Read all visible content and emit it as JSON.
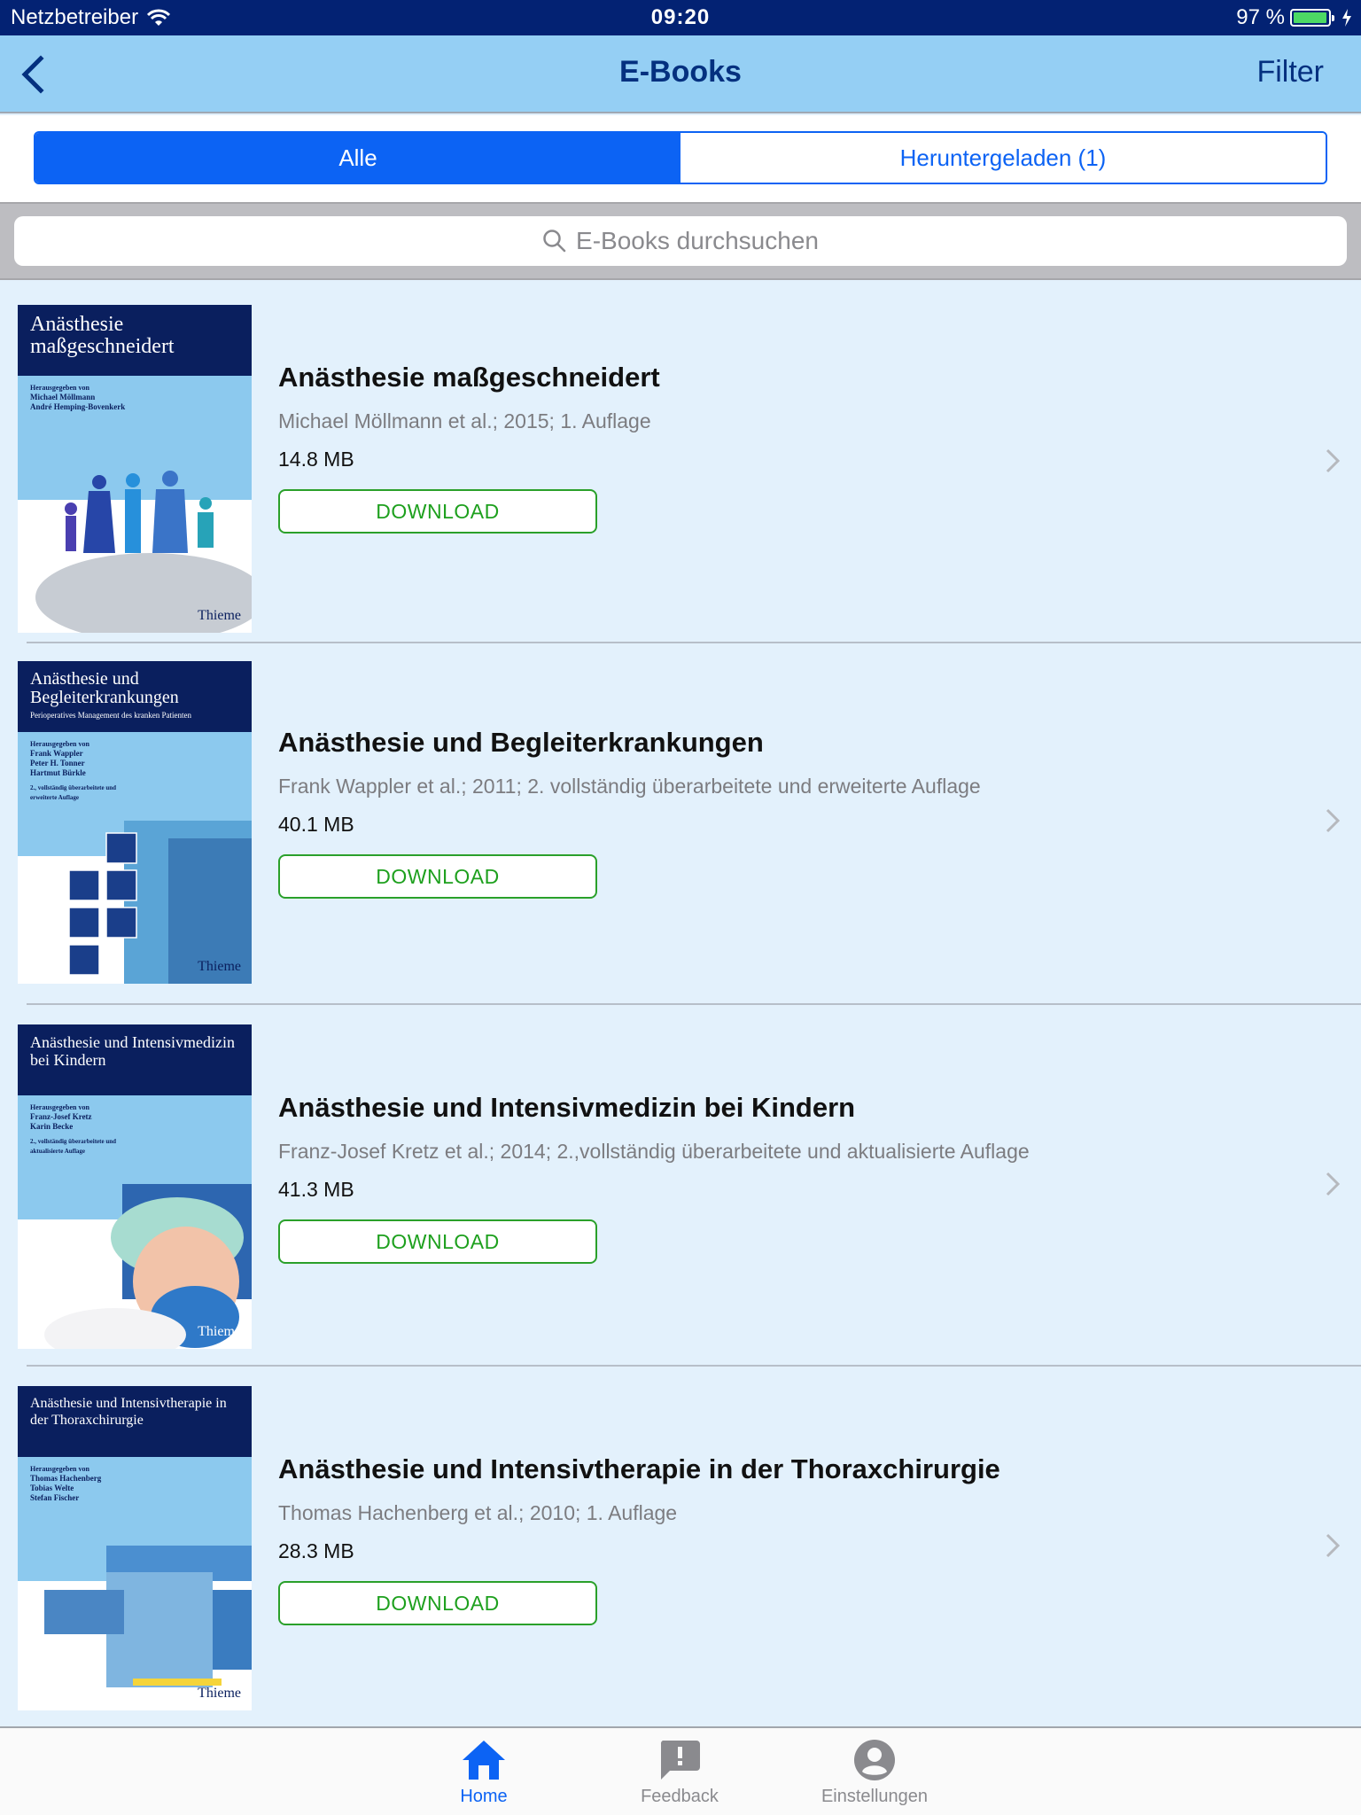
{
  "status_bar": {
    "carrier": "Netzbetreiber",
    "time": "09:20",
    "battery_text": "97 %",
    "battery_level": 0.97
  },
  "nav": {
    "title": "E-Books",
    "filter_label": "Filter"
  },
  "segments": [
    {
      "label": "Alle",
      "active": true
    },
    {
      "label": "Heruntergeladen (1)",
      "active": false
    }
  ],
  "search": {
    "placeholder": "E-Books durchsuchen"
  },
  "books": [
    {
      "title": "Anästhesie maßgeschneidert",
      "meta": "Michael Möllmann et al.; 2015; 1. Auflage",
      "size": "14.8 MB",
      "download_label": "DOWNLOAD",
      "cover": {
        "title": "Anästhesie maßgeschneidert",
        "subtitle": "",
        "editors_label": "Herausgegeben von",
        "editors": [
          "Michael Möllmann",
          "André Hemping-Bovenkerk"
        ],
        "edition": "",
        "publisher": "Thieme"
      }
    },
    {
      "title": "Anästhesie und Begleiterkrankungen",
      "meta": "Frank Wappler et al.; 2011; 2. vollständig überarbeitete und erweiterte Auflage",
      "size": "40.1 MB",
      "download_label": "DOWNLOAD",
      "cover": {
        "title": "Anästhesie und Begleiterkrankungen",
        "subtitle": "Perioperatives Management des kranken Patienten",
        "editors_label": "Herausgegeben von",
        "editors": [
          "Frank Wappler",
          "Peter H. Tonner",
          "Hartmut Bürkle"
        ],
        "edition": "2., vollständig überarbeitete und erweiterte Auflage",
        "publisher": "Thieme"
      }
    },
    {
      "title": "Anästhesie und Intensivmedizin bei Kindern",
      "meta": "Franz-Josef Kretz et al.; 2014; 2.,vollständig überarbeitete und aktualisierte Auflage",
      "size": "41.3 MB",
      "download_label": "DOWNLOAD",
      "cover": {
        "title": "Anästhesie und Intensivmedizin bei Kindern",
        "subtitle": "",
        "editors_label": "Herausgegeben von",
        "editors": [
          "Franz-Josef Kretz",
          "Karin Becke"
        ],
        "edition": "2., vollständig überarbeitete und aktualisierte Auflage",
        "publisher": "Thieme"
      }
    },
    {
      "title": "Anästhesie und Intensivtherapie in der Thoraxchirurgie",
      "meta": "Thomas Hachenberg et al.; 2010; 1. Auflage",
      "size": "28.3 MB",
      "download_label": "DOWNLOAD",
      "cover": {
        "title": "Anästhesie und Intensivtherapie in der Thoraxchirurgie",
        "subtitle": "",
        "editors_label": "Herausgegeben von",
        "editors": [
          "Thomas Hachenberg",
          "Tobias Welte",
          "Stefan Fischer"
        ],
        "edition": "",
        "publisher": "Thieme"
      }
    }
  ],
  "tabbar": [
    {
      "label": "Home",
      "icon": "home-icon",
      "active": true
    },
    {
      "label": "Feedback",
      "icon": "feedback-icon",
      "active": false
    },
    {
      "label": "Einstellungen",
      "icon": "profile-icon",
      "active": false
    }
  ],
  "colors": {
    "status_bar_bg": "#032273",
    "nav_bg": "#95cff4",
    "nav_text": "#04307f",
    "accent_blue": "#0c63f4",
    "download_green": "#1ea01e",
    "list_bg": "#e3f1fc",
    "battery_green": "#4cd964"
  }
}
